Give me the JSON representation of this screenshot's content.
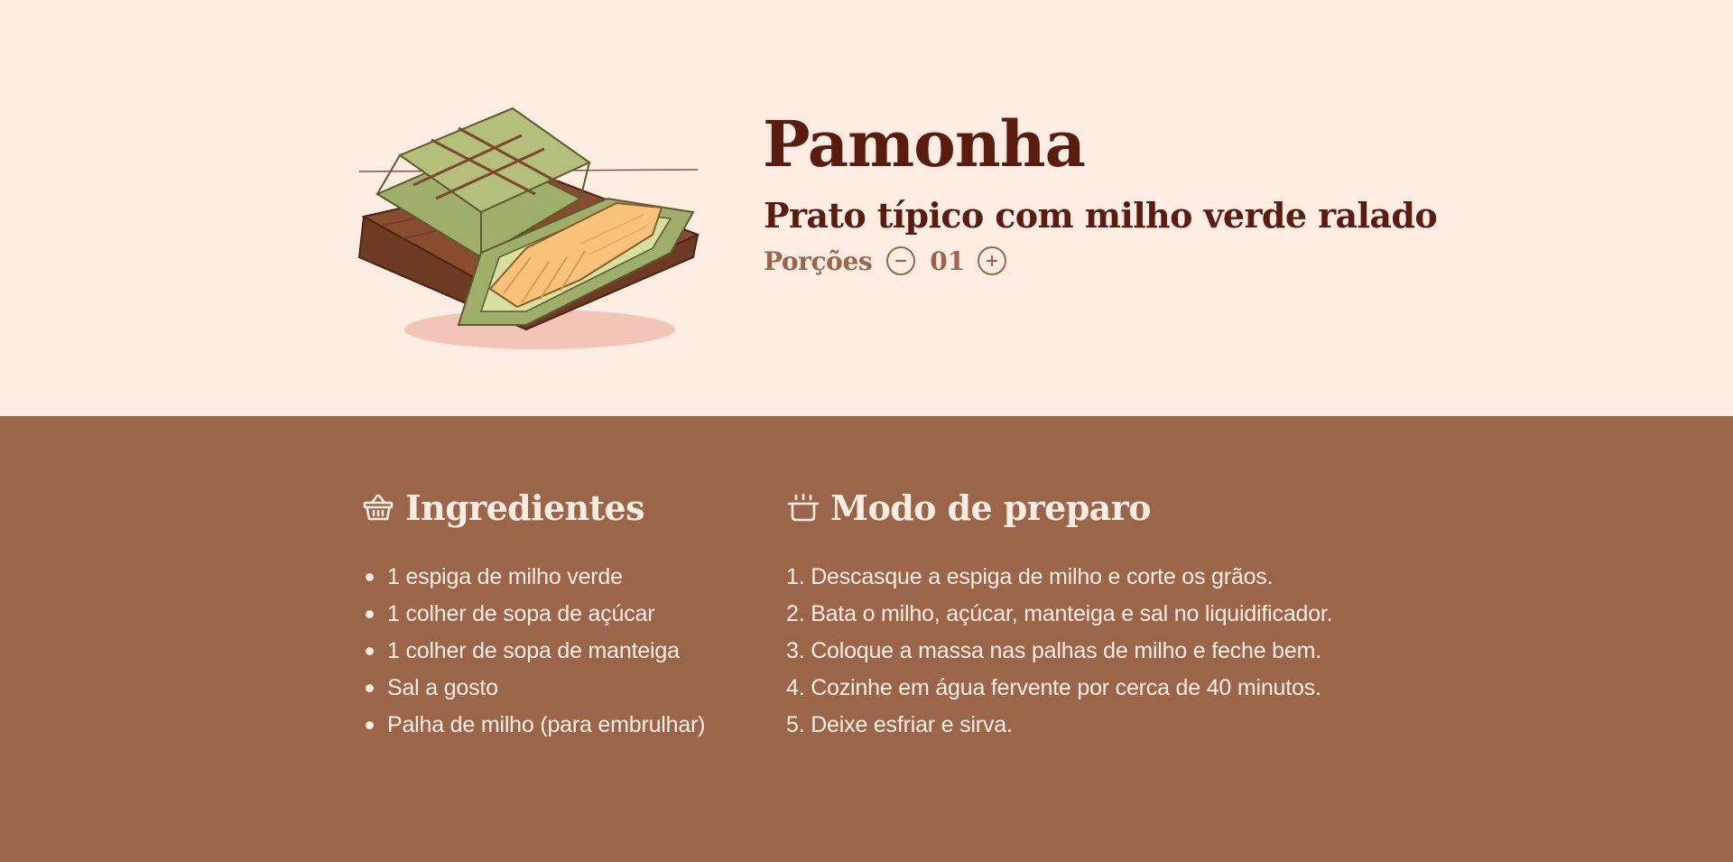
{
  "recipe": {
    "title": "Pamonha",
    "subtitle": "Prato típico com milho verde ralado",
    "servings": {
      "label": "Porções",
      "count": "01"
    }
  },
  "ingredients": {
    "heading": "Ingredientes",
    "icon": "basket-icon",
    "items": [
      "1 espiga de milho verde",
      "1 colher de sopa de açúcar",
      "1 colher de sopa de manteiga",
      "Sal a gosto",
      "Palha de milho (para embrulhar)"
    ]
  },
  "preparation": {
    "heading": "Modo de preparo",
    "icon": "cooking-pot-icon",
    "steps": [
      "1. Descasque a espiga de milho e corte os grãos.",
      "2. Bata o milho, açúcar, manteiga e sal no liquidificador.",
      "3. Coloque a massa nas palhas de milho e feche bem.",
      "4. Cozinhe em água fervente por cerca de 40 minutos.",
      "5. Deixe esfriar e sirva."
    ]
  },
  "colors": {
    "hero_background": "#ffede3",
    "body_background": "#9b654a",
    "title_text": "#5a1c0e",
    "accent": "#9b654a",
    "light_text": "#ffede3"
  }
}
